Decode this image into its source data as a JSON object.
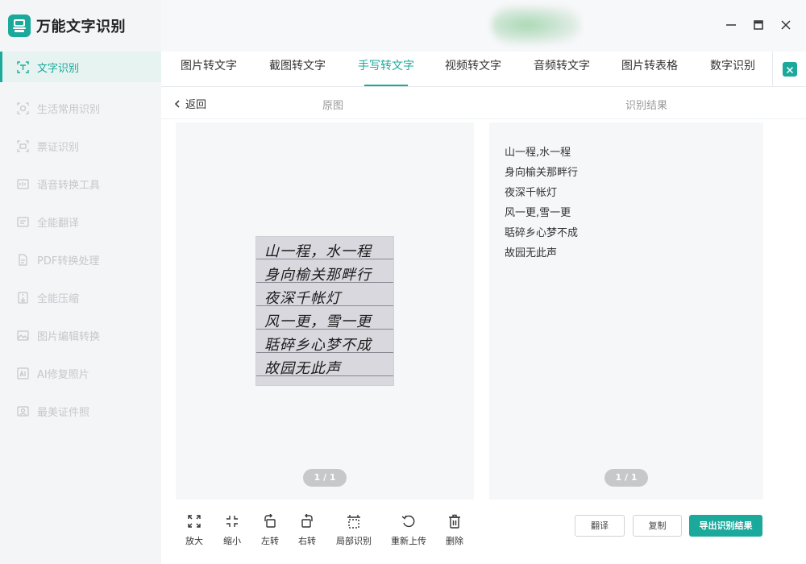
{
  "app": {
    "title": "万能文字识别"
  },
  "sidebar": {
    "items": [
      {
        "label": "文字识别",
        "icon": "scan-text-icon",
        "active": true
      },
      {
        "label": "生活常用识别",
        "icon": "scan-life-icon"
      },
      {
        "label": "票证识别",
        "icon": "ticket-scan-icon"
      },
      {
        "label": "语音转换工具",
        "icon": "voice-convert-icon"
      },
      {
        "label": "全能翻译",
        "icon": "translate-icon"
      },
      {
        "label": "PDF转换处理",
        "icon": "pdf-icon"
      },
      {
        "label": "全能压缩",
        "icon": "compress-icon"
      },
      {
        "label": "图片编辑转换",
        "icon": "image-edit-icon"
      },
      {
        "label": "AI修复照片",
        "icon": "ai-repair-icon"
      },
      {
        "label": "最美证件照",
        "icon": "id-photo-icon"
      }
    ]
  },
  "tabs": [
    {
      "label": "图片转文字"
    },
    {
      "label": "截图转文字"
    },
    {
      "label": "手写转文字",
      "active": true
    },
    {
      "label": "视频转文字"
    },
    {
      "label": "音频转文字"
    },
    {
      "label": "图片转表格"
    },
    {
      "label": "数字识别"
    }
  ],
  "subheader": {
    "back": "返回",
    "original": "原图",
    "result": "识别结果"
  },
  "scan": {
    "lines": [
      "山一程，水一程",
      "身向榆关那畔行",
      "夜深千帐灯",
      "风一更，雪一更",
      "聒碎乡心梦不成",
      "故园无此声"
    ]
  },
  "result": {
    "lines": [
      "山一程,水一程",
      "身向榆关那畔行",
      "夜深千帐灯",
      "风一更,雪一更",
      "聒碎乡心梦不成",
      "故园无此声"
    ]
  },
  "pager": {
    "left": "1 / 1",
    "right": "1 / 1"
  },
  "toolbar": {
    "tools": [
      {
        "label": "放大",
        "icon": "zoom-in-icon"
      },
      {
        "label": "缩小",
        "icon": "zoom-out-icon"
      },
      {
        "label": "左转",
        "icon": "rotate-left-icon"
      },
      {
        "label": "右转",
        "icon": "rotate-right-icon"
      },
      {
        "label": "局部识别",
        "icon": "partial-recognize-icon"
      },
      {
        "label": "重新上传",
        "icon": "reupload-icon"
      },
      {
        "label": "删除",
        "icon": "trash-icon"
      }
    ],
    "translate": "翻译",
    "copy": "复制",
    "export": "导出识别结果"
  },
  "colors": {
    "accent": "#1aa99b"
  }
}
